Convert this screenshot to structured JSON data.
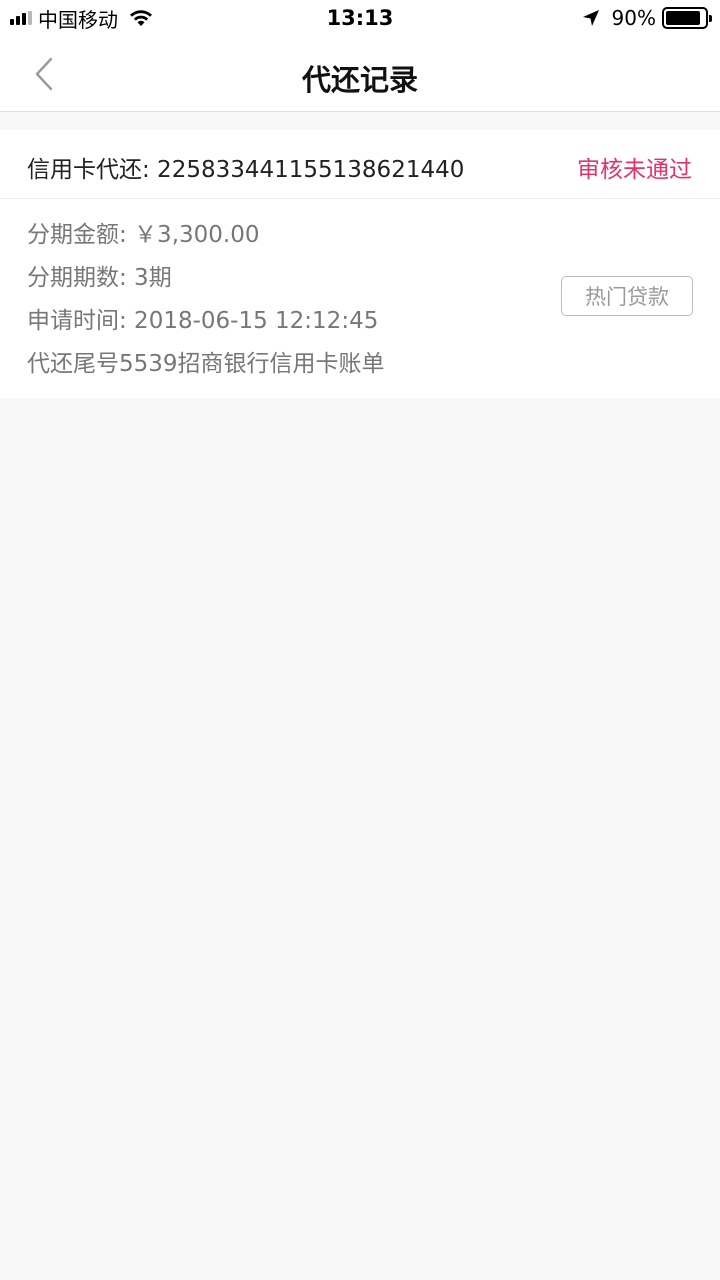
{
  "status_bar": {
    "carrier": "中国移动",
    "time": "13:13",
    "battery_percent": "90%",
    "battery_level": 0.9,
    "icons": [
      "signal-icon",
      "wifi-icon",
      "location-arrow-icon",
      "battery-icon"
    ]
  },
  "nav": {
    "title": "代还记录",
    "back_icon": "chevron-left-icon"
  },
  "record": {
    "type_label": "信用卡代还: 2258334411551386214​40",
    "status": "审核未通过",
    "status_color": "#e8306a",
    "details": {
      "amount": "分期金额: ￥3,300.00",
      "periods": "分期期数: 3期",
      "apply_time": "申请时间: 2018-06-15 12:12:45",
      "bill": "代还尾号5539招商银行信用卡账单"
    },
    "hot_loan_button": "热门贷款"
  }
}
